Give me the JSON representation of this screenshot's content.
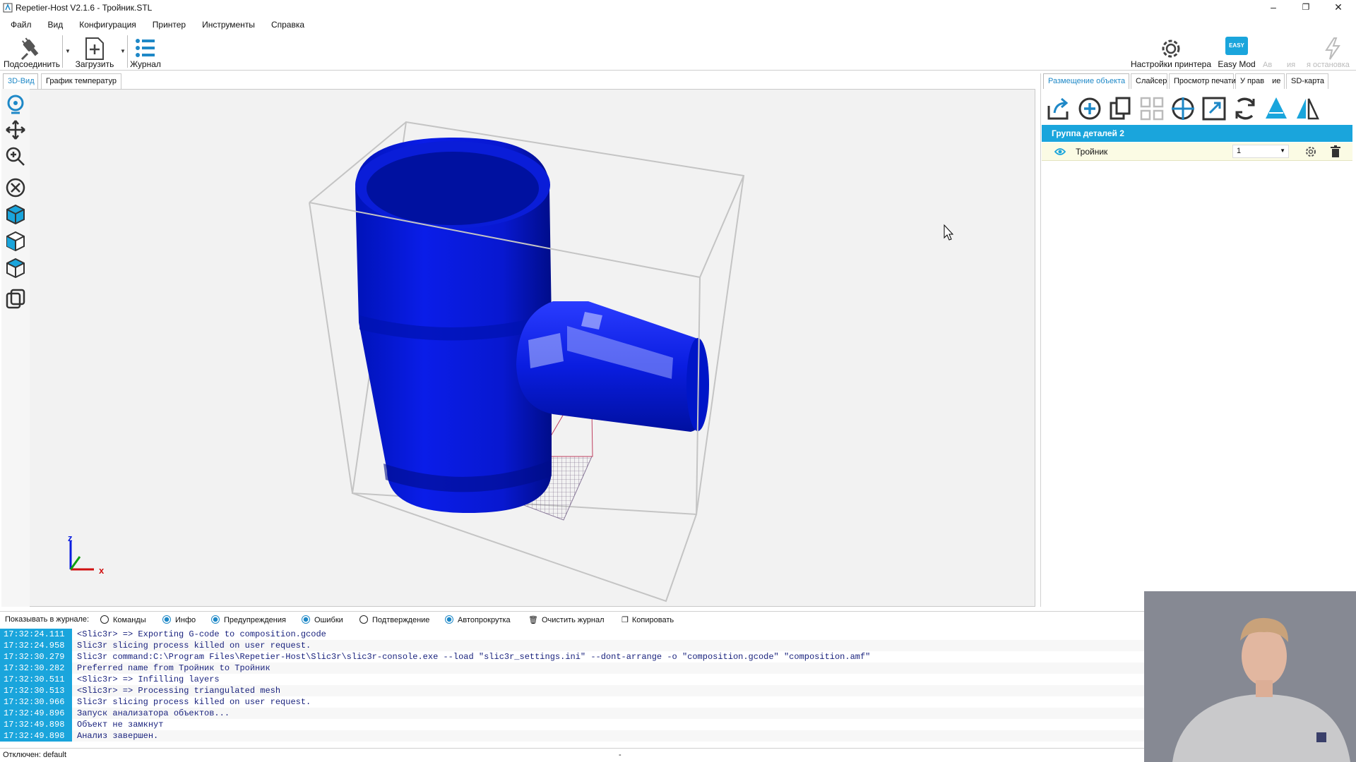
{
  "window": {
    "title": "Repetier-Host V2.1.6 - Тройник.STL",
    "minimize": "–",
    "restore": "❐",
    "close": "✕"
  },
  "menu": [
    "Файл",
    "Вид",
    "Конфигурация",
    "Принтер",
    "Инструменты",
    "Справка"
  ],
  "toolbar": {
    "connect": "Подсоединить",
    "load": "Загрузить",
    "log": "Журнал",
    "printer_settings": "Настройки принтера",
    "easy_mode": "Easy Mod",
    "easy_badge": "EASY",
    "emergency_a": "Ав",
    "emergency_b": "ия",
    "emergency_c": "я остановка"
  },
  "left_tabs": [
    "3D-Вид",
    "График температур"
  ],
  "viewport": {
    "axis_x": "x",
    "axis_z": "z",
    "model_color": "#0a1de0"
  },
  "right_tabs": [
    "Размещение объекта",
    "Слайсер",
    "Просмотр печати",
    "Управление",
    "SD-карта"
  ],
  "right_tab_labels": {
    "t0": "Размещение объекта",
    "t1": "Слайсер",
    "t2": "Просмотр печати",
    "t3": "У прав",
    "t3b": "ие",
    "t4": "SD-карта"
  },
  "object_panel": {
    "group_title": "Группа деталей 2",
    "object_name": "Тройник",
    "copies": "1"
  },
  "log_options": {
    "show_label": "Показывать в журнале:",
    "commands": "Команды",
    "info": "Инфо",
    "warnings": "Предупреждения",
    "errors": "Ошибки",
    "ack": "Подтверждение",
    "autoscroll": "Автопрокрутка",
    "clear": "Очистить журнал",
    "copy": "Копировать"
  },
  "log": [
    {
      "time": "17:32:24.111",
      "msg": "<Slic3r> => Exporting G-code to composition.gcode"
    },
    {
      "time": "17:32:24.958",
      "msg": "Slic3r slicing process killed on user request."
    },
    {
      "time": "17:32:30.279",
      "msg": "Slic3r command:C:\\Program Files\\Repetier-Host\\Slic3r\\slic3r-console.exe --load \"slic3r_settings.ini\" --dont-arrange -o \"composition.gcode\" \"composition.amf\""
    },
    {
      "time": "17:32:30.282",
      "msg": "Preferred name from Тройник to Тройник"
    },
    {
      "time": "17:32:30.511",
      "msg": "<Slic3r> => Infilling layers"
    },
    {
      "time": "17:32:30.513",
      "msg": "<Slic3r> => Processing triangulated mesh"
    },
    {
      "time": "17:32:30.966",
      "msg": "Slic3r slicing process killed on user request."
    },
    {
      "time": "17:32:49.896",
      "msg": "Запуск анализатора объектов..."
    },
    {
      "time": "17:32:49.898",
      "msg": "Объект не замкнут"
    },
    {
      "time": "17:32:49.898",
      "msg": "Анализ завершен."
    }
  ],
  "status": {
    "left": "Отключен: default",
    "mid": "-"
  },
  "colors": {
    "accent": "#1aa5dc",
    "tab_active": "#1e88c7",
    "model": "#0a1de0"
  }
}
